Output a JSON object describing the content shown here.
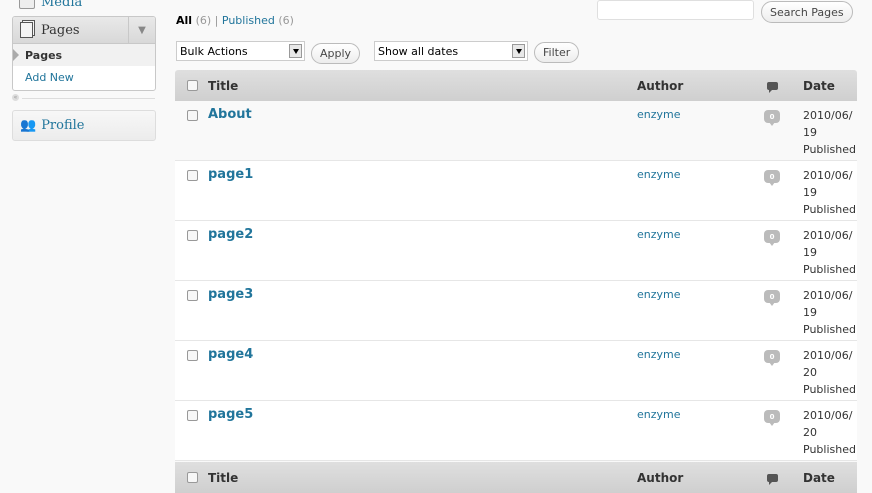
{
  "sidebar": {
    "media_label": "Media",
    "pages_label": "Pages",
    "pages_toggle": "▼",
    "submenu": [
      "Pages",
      "Add New"
    ],
    "profile_label": "Profile"
  },
  "filters": {
    "all_label": "All",
    "all_count": "(6)",
    "separator": "|",
    "published_label": "Published",
    "published_count": "(6)"
  },
  "search": {
    "value": "",
    "button": "Search Pages"
  },
  "bulk": {
    "actions_select": "Bulk Actions",
    "apply_button": "Apply",
    "dates_select": "Show all dates",
    "filter_button": "Filter"
  },
  "table": {
    "columns": {
      "title": "Title",
      "author": "Author",
      "date": "Date"
    },
    "rows": [
      {
        "title": "About",
        "author": "enzyme",
        "comments": "0",
        "date": "2010/06/\n19\nPublished"
      },
      {
        "title": "page1",
        "author": "enzyme",
        "comments": "0",
        "date": "2010/06/\n19\nPublished"
      },
      {
        "title": "page2",
        "author": "enzyme",
        "comments": "0",
        "date": "2010/06/\n19\nPublished"
      },
      {
        "title": "page3",
        "author": "enzyme",
        "comments": "0",
        "date": "2010/06/\n19\nPublished"
      },
      {
        "title": "page4",
        "author": "enzyme",
        "comments": "0",
        "date": "2010/06/\n20\nPublished"
      },
      {
        "title": "page5",
        "author": "enzyme",
        "comments": "0",
        "date": "2010/06/\n20\nPublished"
      }
    ]
  },
  "colors": {
    "link": "#21759b",
    "header_bg": "#dfdfdf",
    "bubble": "#bbbbbb"
  },
  "icons": [
    "media-icon",
    "pages-icon",
    "profile-icon",
    "comments-icon",
    "collapse-icon"
  ]
}
